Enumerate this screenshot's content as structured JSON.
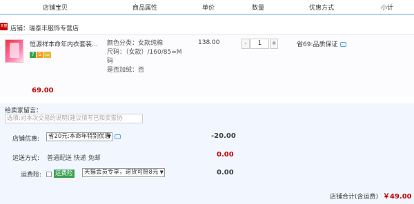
{
  "header": {
    "col_item": "店铺宝贝",
    "col_attrs": "商品属性",
    "col_price": "单价",
    "col_qty": "数量",
    "col_promo": "优惠方式",
    "col_subtotal": "小计"
  },
  "shop": {
    "icon_text": "天猫",
    "name": "店铺：瑞泰丰服饰专营店"
  },
  "item": {
    "title": "恒源祥本命年内衣套装加绒加厚",
    "badge_7": "7",
    "badge_s": "S",
    "attr_color": "颜色分类：女款纯棉",
    "attr_size": "尺码：（女款）/160/85=M码",
    "attr_fleece": "是否加绒：否",
    "price": "138.00",
    "qty_minus": "-",
    "qty_value": "1",
    "qty_plus": "+",
    "promo": "省69:品质保证",
    "subtotal": "69.00"
  },
  "note": {
    "label": "给卖家留言：",
    "placeholder": "选填:对本次交易的说明(建议填写已和卖家协"
  },
  "shop_discount": {
    "label": "店铺优惠:",
    "selected": "省20元:本命年特别优惠",
    "value": "-20.00"
  },
  "shipping": {
    "label": "运送方式:",
    "method": "普通配送 快递 免邮",
    "value": "0.00"
  },
  "insurance": {
    "label": "运费险:",
    "badge": "运费险",
    "selected": "天猫会员专享，退货可赔8元",
    "value": "0.00"
  },
  "total": {
    "label": "店铺合计(含运费)",
    "value": "￥49.00"
  },
  "colors": {
    "accent_red": "#c40000",
    "header_border": "#b2d1ff",
    "section_bg": "#f2f7ff",
    "badge_green": "#3aa14d"
  }
}
